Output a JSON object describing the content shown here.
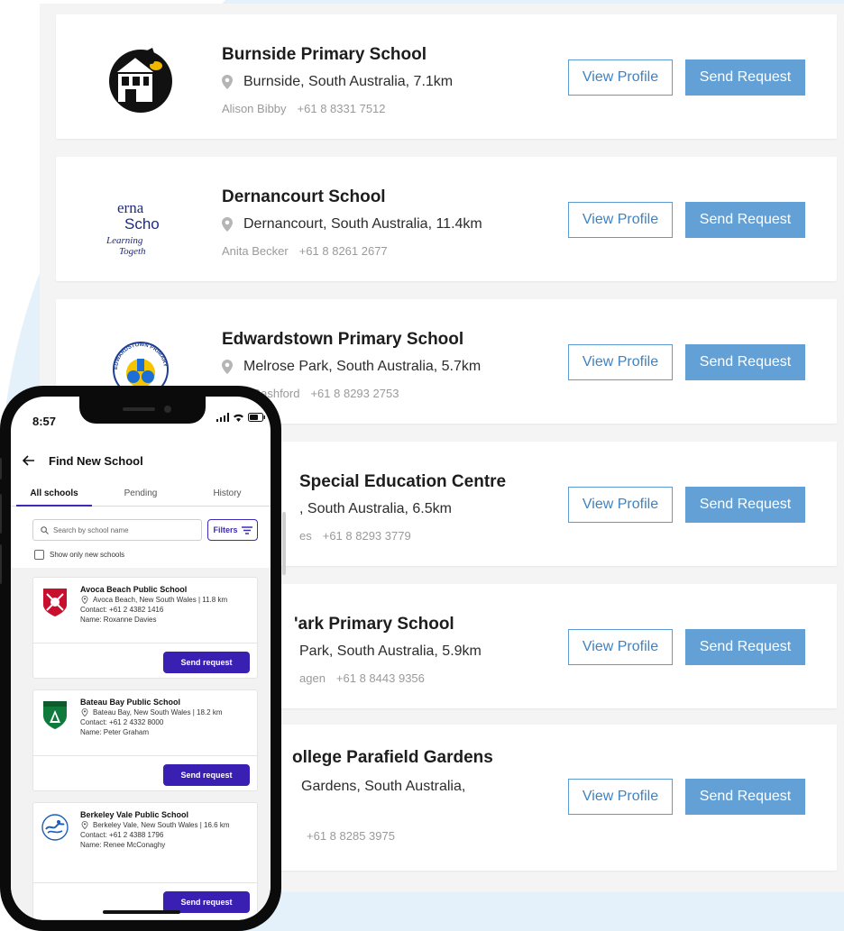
{
  "desktop": {
    "cards": [
      {
        "name": "Burnside Primary School",
        "location": "Burnside, South Australia, 7.1km",
        "contact_name": "Alison Bibby",
        "phone": "+61 8 8331 7512",
        "view_label": "View Profile",
        "send_label": "Send Request"
      },
      {
        "name": "Dernancourt School",
        "location": "Dernancourt, South Australia, 11.4km",
        "contact_name": "Anita Becker",
        "phone": "+61 8 8261 2677",
        "view_label": "View Profile",
        "send_label": "Send Request"
      },
      {
        "name": "Edwardstown Primary School",
        "location": "Melrose Park, South Australia, 5.7km",
        "contact_name": "Vicky Bashford",
        "phone": "+61 8 8293 2753",
        "view_label": "View Profile",
        "send_label": "Send Request"
      },
      {
        "name": "Special Education Centre",
        "location": ", South Australia, 6.5km",
        "contact_name": "es",
        "phone": "+61 8 8293 3779",
        "view_label": "View Profile",
        "send_label": "Send Request"
      },
      {
        "name": "'ark Primary School",
        "location": "Park, South Australia, 5.9km",
        "contact_name": "agen",
        "phone": "+61 8 8443 9356",
        "view_label": "View Profile",
        "send_label": "Send Request"
      },
      {
        "name": "ollege Parafield Gardens",
        "location": "Gardens, South Australia,",
        "contact_name": "",
        "phone": "+61 8 8285 3975",
        "view_label": "View Profile",
        "send_label": "Send Request"
      }
    ],
    "logo_text": {
      "dernancourt_line1": "erna",
      "dernancourt_line2": "Scho",
      "dernancourt_line3": "Learning",
      "dernancourt_line4": "Togeth",
      "edwardstown_ring": "EDWARDSTOWN PRIMARY SCHOOL"
    }
  },
  "phone": {
    "time": "8:57",
    "title": "Find New School",
    "tabs": [
      {
        "label": "All schools"
      },
      {
        "label": "Pending"
      },
      {
        "label": "History"
      }
    ],
    "search_placeholder": "Search by school name",
    "filters_label": "Filters",
    "show_new_label": "Show only new schools",
    "schools": [
      {
        "name": "Avoca Beach Public School",
        "location": "Avoca Beach, New South Wales | 11.8 km",
        "contact": "Contact: +61 2 4382 1416",
        "person": "Name: Roxanne Davies",
        "send_label": "Send request"
      },
      {
        "name": "Bateau Bay Public School",
        "location": "Bateau Bay, New South Wales | 18.2 km",
        "contact": "Contact: +61 2 4332 8000",
        "person": "Name: Peter Graham",
        "send_label": "Send request"
      },
      {
        "name": "Berkeley Vale Public School",
        "location": "Berkeley Vale, New South Wales | 16.6 km",
        "contact": "Contact: +61 2 4388 1796",
        "person": "Name: Renee McConaghy",
        "send_label": "Send request"
      }
    ]
  },
  "colors": {
    "view_border": "#5b9bd1",
    "send_bg": "#62a0d5",
    "mobile_accent": "#3a1fb3",
    "blob": "#e4f1fa"
  }
}
